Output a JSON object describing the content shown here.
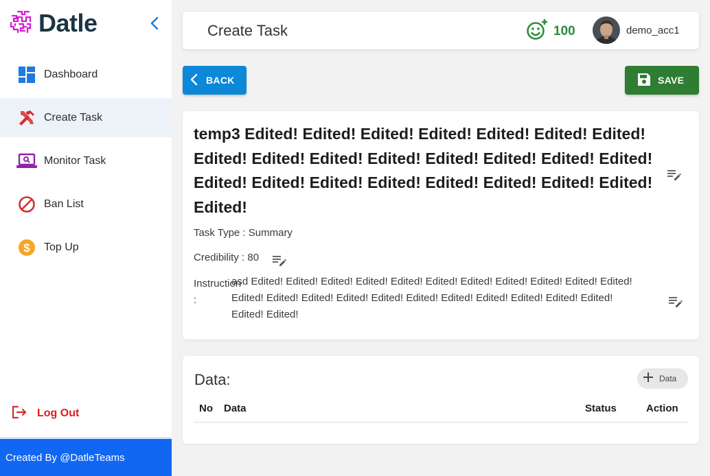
{
  "app": {
    "name": "Datle"
  },
  "sidebar": {
    "items": [
      {
        "label": "Dashboard",
        "icon": "dashboard-icon",
        "color": "#1e7be0"
      },
      {
        "label": "Create Task",
        "icon": "tools-icon",
        "color": "#d32f2f"
      },
      {
        "label": "Monitor Task",
        "icon": "laptop-icon",
        "color": "#8e24aa"
      },
      {
        "label": "Ban List",
        "icon": "ban-icon",
        "color": "#d32f2f"
      },
      {
        "label": "Top Up",
        "icon": "dollar-coin-icon",
        "color": "#f5a623"
      }
    ],
    "active_index": 1,
    "logout_label": "Log Out",
    "footer_text": "Created By @DatleTeams"
  },
  "header": {
    "title": "Create Task",
    "points": "100",
    "username": "demo_acc1"
  },
  "toolbar": {
    "back_label": "BACK",
    "save_label": "SAVE"
  },
  "task": {
    "title": "temp3 Edited! Edited! Edited! Edited! Edited! Edited! Edited! Edited! Edited! Edited! Edited! Edited! Edited! Edited! Edited! Edited! Edited! Edited! Edited! Edited! Edited! Edited! Edited! Edited!",
    "type_text": "Task Type : Summary",
    "credibility_text": "Credibility : 80",
    "instruction_label": "Instruction :",
    "instruction_text": "asd Edited! Edited! Edited! Edited! Edited! Edited! Edited! Edited! Edited! Edited! Edited! Edited! Edited! Edited! Edited! Edited! Edited! Edited! Edited! Edited! Edited! Edited! Edited! Edited!"
  },
  "data_section": {
    "title": "Data:",
    "add_label": "Data",
    "columns": [
      "No",
      "Data",
      "Status",
      "Action"
    ],
    "rows": []
  },
  "colors": {
    "primary_blue": "#1167f2",
    "back_button": "#0b88d8",
    "save_button": "#2f7d32",
    "points_green": "#2e8b3e",
    "logout_red": "#e11b1b",
    "logo_magenta": "#d61ad6"
  }
}
